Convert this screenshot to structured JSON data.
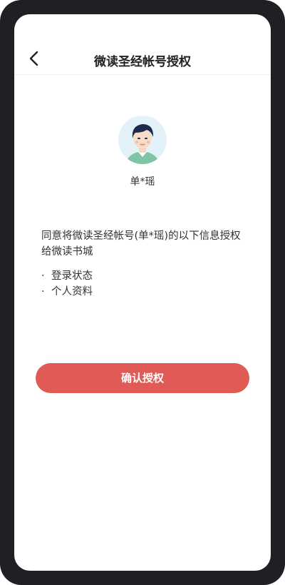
{
  "header": {
    "title": "微读圣经帐号授权",
    "back_icon": "chevron-left-icon"
  },
  "account": {
    "avatar_icon": "avatar-illustration",
    "username": "单*瑶"
  },
  "consent": {
    "text": "同意将微读圣经帐号(单*瑶)的以下信息授权给微读书城",
    "permissions": [
      "登录状态",
      "个人资料"
    ],
    "bullet": "·"
  },
  "actions": {
    "confirm_label": "确认授权"
  },
  "colors": {
    "accent": "#e05b55",
    "frame": "#1f2024"
  }
}
